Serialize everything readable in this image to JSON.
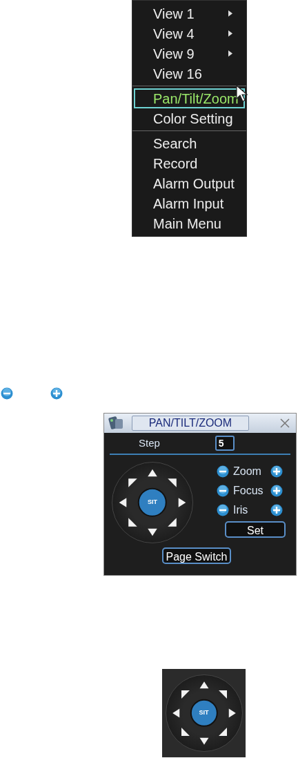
{
  "menu": {
    "groups": [
      {
        "items": [
          {
            "label": "View 1",
            "selected": false,
            "has_submenu": true
          },
          {
            "label": "View 4",
            "selected": false,
            "has_submenu": true
          },
          {
            "label": "View 9",
            "selected": false,
            "has_submenu": true
          },
          {
            "label": "View 16",
            "selected": false,
            "has_submenu": false
          }
        ]
      },
      {
        "items": [
          {
            "label": "Pan/Tilt/Zoom",
            "selected": true,
            "has_submenu": false
          },
          {
            "label": "Color Setting",
            "selected": false,
            "has_submenu": false
          }
        ]
      },
      {
        "items": [
          {
            "label": "Search",
            "selected": false,
            "has_submenu": false
          },
          {
            "label": "Record",
            "selected": false,
            "has_submenu": false
          },
          {
            "label": "Alarm Output",
            "selected": false,
            "has_submenu": false
          },
          {
            "label": "Alarm Input",
            "selected": false,
            "has_submenu": false
          },
          {
            "label": "Main Menu",
            "selected": false,
            "has_submenu": false
          }
        ]
      }
    ]
  },
  "ptz_panel": {
    "title": "PAN/TILT/ZOOM",
    "step": {
      "label": "Step",
      "value": "5"
    },
    "dial": {
      "center": "SIT"
    },
    "adjustments": [
      {
        "label": "Zoom"
      },
      {
        "label": "Focus"
      },
      {
        "label": "Iris"
      }
    ],
    "set_button": "Set",
    "page_switch_button": "Page Switch"
  },
  "dial_closeup": {
    "center": "SIT"
  }
}
